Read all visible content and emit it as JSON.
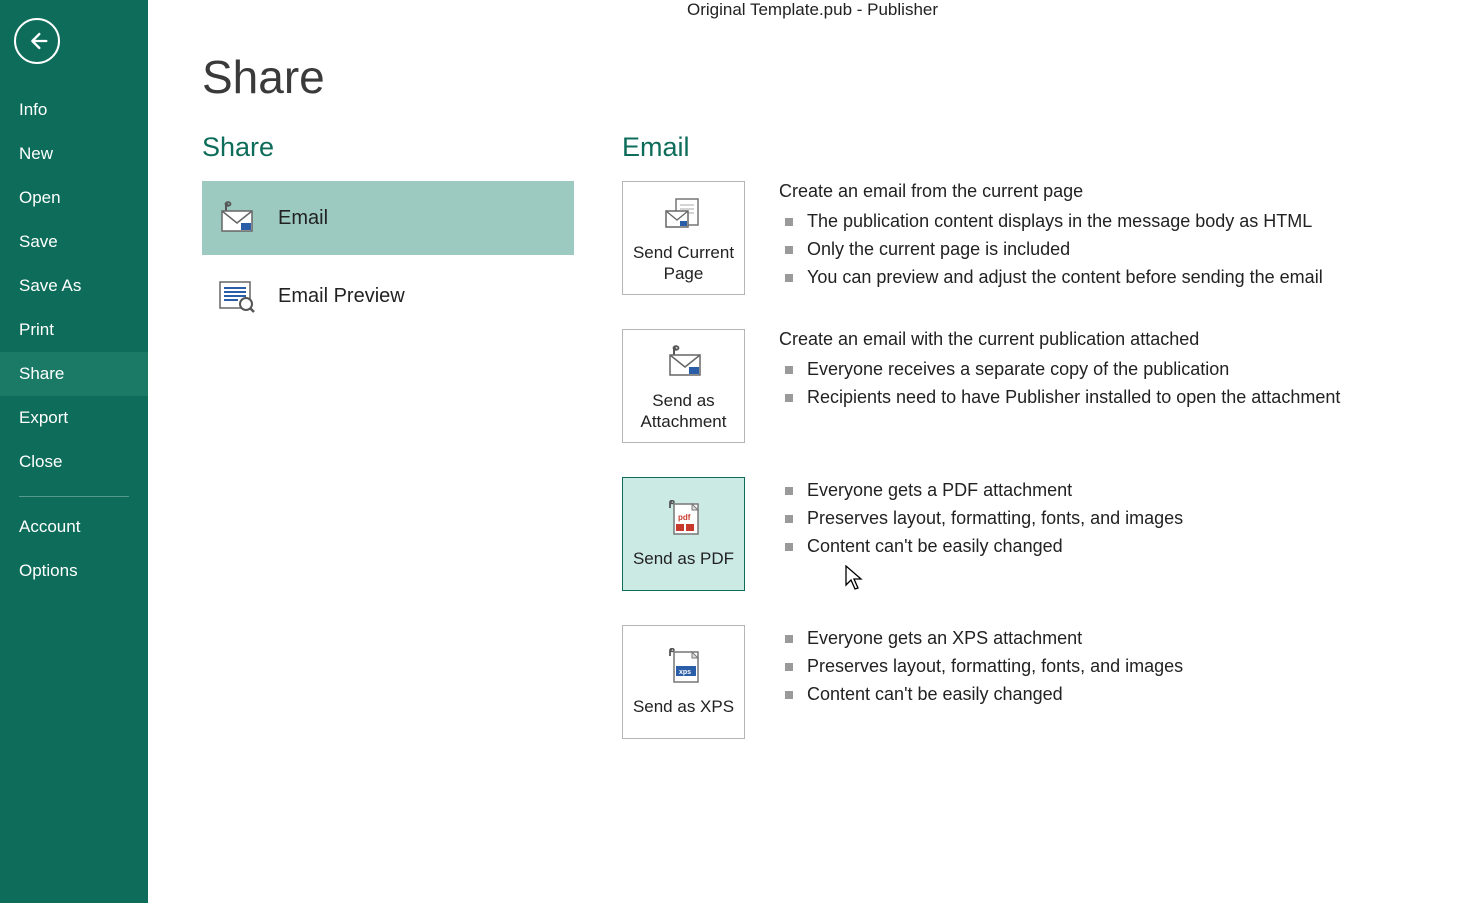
{
  "window_title": "Original Template.pub - Publisher",
  "nav": {
    "items": [
      {
        "label": "Info"
      },
      {
        "label": "New"
      },
      {
        "label": "Open"
      },
      {
        "label": "Save"
      },
      {
        "label": "Save As"
      },
      {
        "label": "Print"
      },
      {
        "label": "Share"
      },
      {
        "label": "Export"
      },
      {
        "label": "Close"
      }
    ],
    "sub_items": [
      {
        "label": "Account"
      },
      {
        "label": "Options"
      }
    ],
    "active": "Share"
  },
  "page": {
    "title": "Share"
  },
  "share": {
    "title": "Share",
    "options": [
      {
        "label": "Email",
        "selected": true
      },
      {
        "label": "Email Preview",
        "selected": false
      }
    ]
  },
  "email": {
    "title": "Email",
    "blocks": [
      {
        "button_label": "Send Current Page",
        "header": "Create an email from the current page",
        "bullets": [
          "The publication content displays in the message body as HTML",
          "Only the current page is included",
          "You can preview and adjust the content before sending the email"
        ],
        "hover": false
      },
      {
        "button_label": "Send as Attachment",
        "header": "Create an email with the current publication attached",
        "bullets": [
          "Everyone receives a separate copy of the publication",
          "Recipients need to have Publisher installed to open the attachment"
        ],
        "hover": false
      },
      {
        "button_label": "Send as PDF",
        "header": "",
        "bullets": [
          "Everyone gets a PDF attachment",
          "Preserves layout, formatting, fonts, and images",
          "Content can't be easily changed"
        ],
        "hover": true
      },
      {
        "button_label": "Send as XPS",
        "header": "",
        "bullets": [
          "Everyone gets an XPS attachment",
          "Preserves layout, formatting, fonts, and images",
          "Content can't be easily changed"
        ],
        "hover": false
      }
    ]
  }
}
